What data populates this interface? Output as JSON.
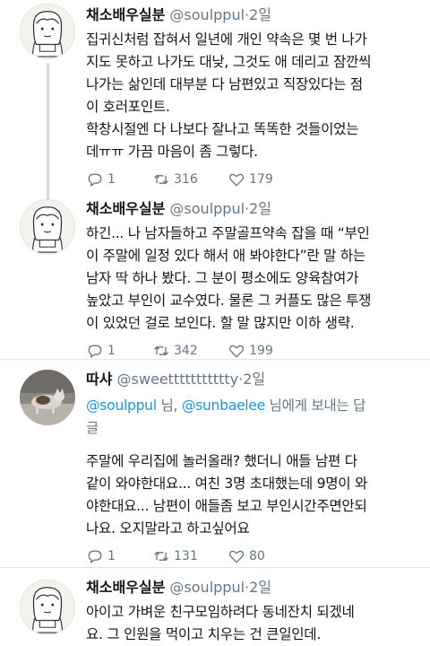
{
  "tweets": [
    {
      "name": "채소배우실분",
      "handle": "@soulppul",
      "dot": "·",
      "time": "2일",
      "lines": [
        "집귀신처럼 잡혀서 일년에 개인 약속은 몇 번 나가",
        "지도 못하고 나가도 대낮, 그것도 애 데리고 잠깐씩",
        "나가는 삶인데 대부분 다 남편있고 직장있다는 점",
        "이 호러포인트.",
        "학창시절엔 다 나보다 잘나고 똑똑한 것들이었는",
        "데ㅠㅠ 가끔 마음이 좀 그렇다."
      ],
      "replies": "1",
      "retweets": "316",
      "likes": "179"
    },
    {
      "name": "채소배우실분",
      "handle": "@soulppul",
      "dot": "·",
      "time": "2일",
      "lines": [
        "하긴... 나 남자들하고 주말골프약속 잡을 때 “부인",
        "이 주말에 일정 있다 해서 애 봐야한다”란 말 하는",
        "남자 딱 하나 봤다. 그 분이 평소에도 양육참여가",
        "높았고 부인이 교수였다. 물론 그 커플도 많은 투쟁",
        "이 있었던 걸로 보인다. 할 말 많지만 이하 생략."
      ],
      "replies": "1",
      "retweets": "342",
      "likes": "199"
    },
    {
      "name": "따샤",
      "handle": "@sweettttttttttty",
      "dot": "·",
      "time": "2일",
      "replying": {
        "mention1": "@soulppul",
        "sep1": " 님, ",
        "mention2": "@sunbaelee",
        "suffix_line1": " 님에게 보내는 답",
        "suffix_line2": "글"
      },
      "lines": [
        "주말에 우리집에 놀러올래? 했더니 애들 남편 다",
        "같이 와야한대요... 여친 3명 초대했는데 9명이 와",
        "야한대요... 남편이 애들좀 보고 부인시간주면안되",
        "나요. 오지말라고 하고싶어요"
      ],
      "replies": "1",
      "retweets": "131",
      "likes": "80"
    },
    {
      "name": "채소배우실분",
      "handle": "@soulppul",
      "dot": "·",
      "time": "2일",
      "lines": [
        "아이고 가벼운 친구모임하려다 동네잔치 되겠네",
        "요. 그 인원을 먹이고 치우는 건 큰일인데."
      ]
    }
  ],
  "icons": {
    "reply": "reply-icon",
    "retweet": "retweet-icon",
    "like": "heart-icon"
  },
  "colors": {
    "text": "#14171a",
    "muted": "#657786",
    "link": "#1b95e0",
    "divider": "#e1e8ed"
  }
}
